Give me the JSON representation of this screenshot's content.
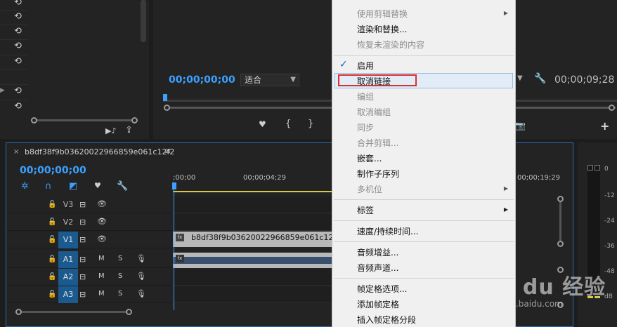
{
  "project_panel": {
    "undo_glyph": "⟲",
    "footer_icons": [
      "▶♪",
      "⇪"
    ]
  },
  "program_monitor": {
    "timecode_left": "00;00;00;00",
    "fit_label": "适合",
    "timecode_right": "00;00;09;28",
    "controls": [
      "♥",
      "{",
      "}"
    ],
    "add_button": "+"
  },
  "timeline": {
    "sequence_title": "b8df38f9b03620022966859e061c12f2",
    "close_glyph": "×",
    "menu_glyph": "≡",
    "timecode": "00;00;00;00",
    "ruler_labels": [
      ";00;00",
      "00;00;04;29",
      "00;00;19;29"
    ],
    "tracks": [
      {
        "name": "V3",
        "type": "video",
        "active": false
      },
      {
        "name": "V2",
        "type": "video",
        "active": false
      },
      {
        "name": "V1",
        "type": "video",
        "active": true
      },
      {
        "name": "A1",
        "type": "audio",
        "active": true
      },
      {
        "name": "A2",
        "type": "audio",
        "active": true
      },
      {
        "name": "A3",
        "type": "audio",
        "active": true
      }
    ],
    "audio_track_labels": {
      "m": "M",
      "s": "S"
    },
    "clip_v1_name": "b8df38f9b03620022966859e061c12f2.m",
    "fx_label": "fx"
  },
  "audio_meters": {
    "scale": [
      "0",
      "-12",
      "-24",
      "-36",
      "-48",
      "dB"
    ]
  },
  "context_menu": {
    "items": [
      {
        "label": "使用剪辑替换",
        "disabled": true,
        "submenu": true
      },
      {
        "label": "渲染和替换...",
        "disabled": false,
        "submenu": false
      },
      {
        "label": "恢复未渲染的内容",
        "disabled": true,
        "submenu": false
      },
      {
        "label": "启用",
        "disabled": false,
        "checked": true
      },
      {
        "label": "取消链接",
        "disabled": false,
        "highlighted": true
      },
      {
        "label": "编组",
        "disabled": true
      },
      {
        "label": "取消编组",
        "disabled": true
      },
      {
        "label": "同步",
        "disabled": true
      },
      {
        "label": "合并剪辑...",
        "disabled": true
      },
      {
        "label": "嵌套...",
        "disabled": false
      },
      {
        "label": "制作子序列",
        "disabled": false
      },
      {
        "label": "多机位",
        "disabled": true,
        "submenu": true
      },
      {
        "label": "标签",
        "disabled": false,
        "submenu": true
      },
      {
        "label": "速度/持续时间...",
        "disabled": false
      },
      {
        "label": "音频增益...",
        "disabled": false
      },
      {
        "label": "音频声道...",
        "disabled": false
      },
      {
        "label": "帧定格选项...",
        "disabled": false
      },
      {
        "label": "添加帧定格",
        "disabled": false
      },
      {
        "label": "插入帧定格分段",
        "disabled": false
      }
    ],
    "check_glyph": "✓",
    "arrow_glyph": "▶"
  },
  "watermark": {
    "brand": "Bai du 经验",
    "url": "jingyan.baidu.com"
  },
  "colors": {
    "accent_blue": "#3ca0ff",
    "highlight_red": "#d9302f",
    "track_active": "#1b5a8f"
  }
}
